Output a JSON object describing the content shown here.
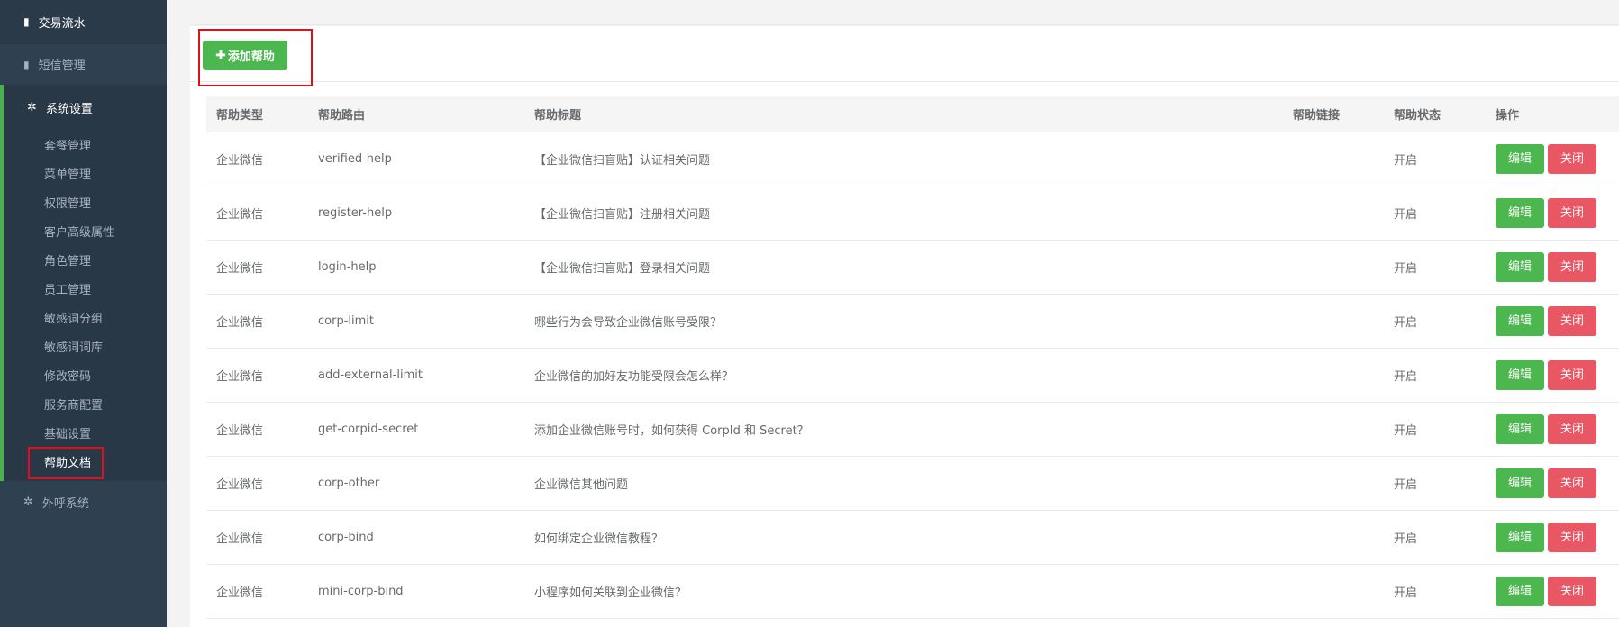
{
  "sidebar": {
    "top_item": {
      "label": "交易流水",
      "icon": "book-icon"
    },
    "sms_item": {
      "label": "短信管理",
      "icon": "book-icon"
    },
    "settings_group": {
      "title": "系统设置",
      "icon": "gear-icon",
      "items": [
        {
          "label": "套餐管理"
        },
        {
          "label": "菜单管理"
        },
        {
          "label": "权限管理"
        },
        {
          "label": "客户高级属性"
        },
        {
          "label": "角色管理"
        },
        {
          "label": "员工管理"
        },
        {
          "label": "敏感词分组"
        },
        {
          "label": "敏感词词库"
        },
        {
          "label": "修改密码"
        },
        {
          "label": "服务商配置"
        },
        {
          "label": "基础设置"
        },
        {
          "label": "帮助文档"
        }
      ],
      "active_index": 11
    },
    "callout_item": {
      "label": "外呼系统",
      "icon": "gear-icon"
    }
  },
  "toolbar": {
    "add_label": "添加帮助",
    "add_icon": "plus-icon"
  },
  "table": {
    "headers": [
      "帮助类型",
      "帮助路由",
      "帮助标题",
      "帮助链接",
      "帮助状态",
      "操作"
    ],
    "rows": [
      {
        "type": "企业微信",
        "route": "verified-help",
        "title": "【企业微信扫盲贴】认证相关问题",
        "link": "",
        "status": "开启"
      },
      {
        "type": "企业微信",
        "route": "register-help",
        "title": "【企业微信扫盲贴】注册相关问题",
        "link": "",
        "status": "开启"
      },
      {
        "type": "企业微信",
        "route": "login-help",
        "title": "【企业微信扫盲贴】登录相关问题",
        "link": "",
        "status": "开启"
      },
      {
        "type": "企业微信",
        "route": "corp-limit",
        "title": "哪些行为会导致企业微信账号受限？",
        "link": "",
        "status": "开启"
      },
      {
        "type": "企业微信",
        "route": "add-external-limit",
        "title": "企业微信的加好友功能受限会怎么样？",
        "link": "",
        "status": "开启"
      },
      {
        "type": "企业微信",
        "route": "get-corpid-secret",
        "title": "添加企业微信账号时，如何获得 CorpId 和 Secret？",
        "link": "",
        "status": "开启"
      },
      {
        "type": "企业微信",
        "route": "corp-other",
        "title": "企业微信其他问题",
        "link": "",
        "status": "开启"
      },
      {
        "type": "企业微信",
        "route": "corp-bind",
        "title": "如何绑定企业微信教程？",
        "link": "",
        "status": "开启"
      },
      {
        "type": "企业微信",
        "route": "mini-corp-bind",
        "title": "小程序如何关联到企业微信？",
        "link": "",
        "status": "开启"
      }
    ],
    "edit_label": "编辑",
    "close_label": "关闭"
  },
  "colors": {
    "sidebar_bg": "#2f4050",
    "accent_green": "#4cb74f",
    "danger_red": "#e85763",
    "highlight_red": "#e0101a"
  }
}
